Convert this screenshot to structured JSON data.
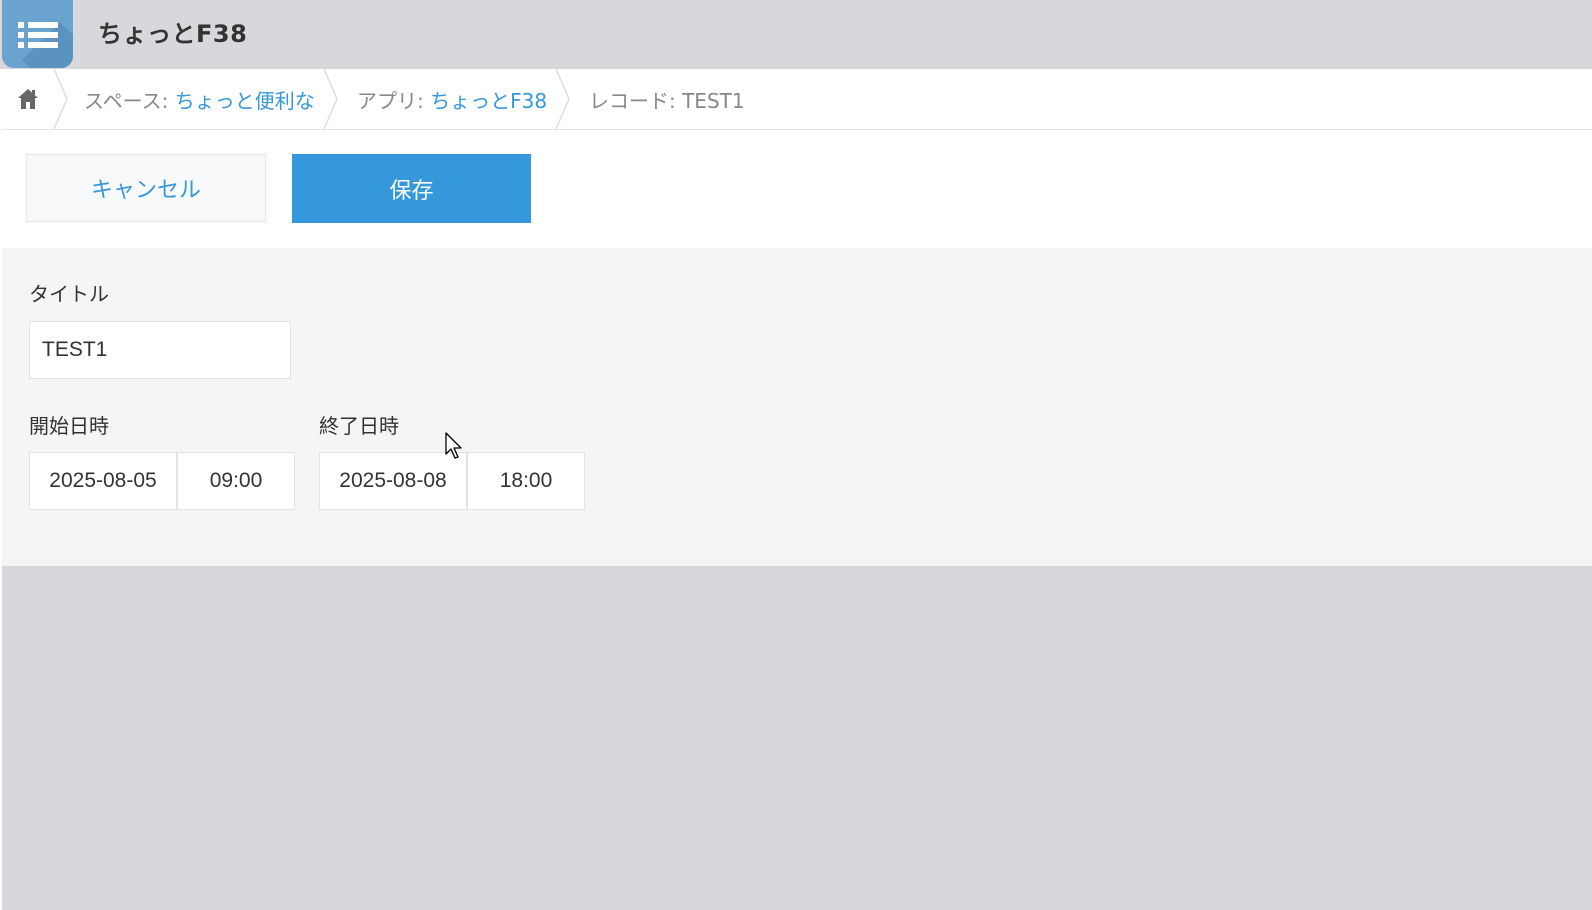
{
  "header": {
    "app_title": "ちょっとF38"
  },
  "breadcrumb": {
    "space_prefix": "スペース: ",
    "space_name": "ちょっと便利な",
    "app_prefix": "アプリ: ",
    "app_name": "ちょっとF38",
    "record_label": "レコード: TEST1"
  },
  "toolbar": {
    "cancel_label": "キャンセル",
    "save_label": "保存"
  },
  "form": {
    "title_label": "タイトル",
    "title_value": "TEST1",
    "start_label": "開始日時",
    "start_date": "2025-08-05",
    "start_time": "09:00",
    "end_label": "終了日時",
    "end_date": "2025-08-08",
    "end_time": "18:00"
  },
  "colors": {
    "accent": "#3498db",
    "app_icon": "#6aa3cf",
    "header_bg": "#d8d7dc",
    "form_bg": "#f5f4f7"
  },
  "icons": [
    "app-list-icon",
    "home-icon",
    "mouse-cursor-icon"
  ]
}
